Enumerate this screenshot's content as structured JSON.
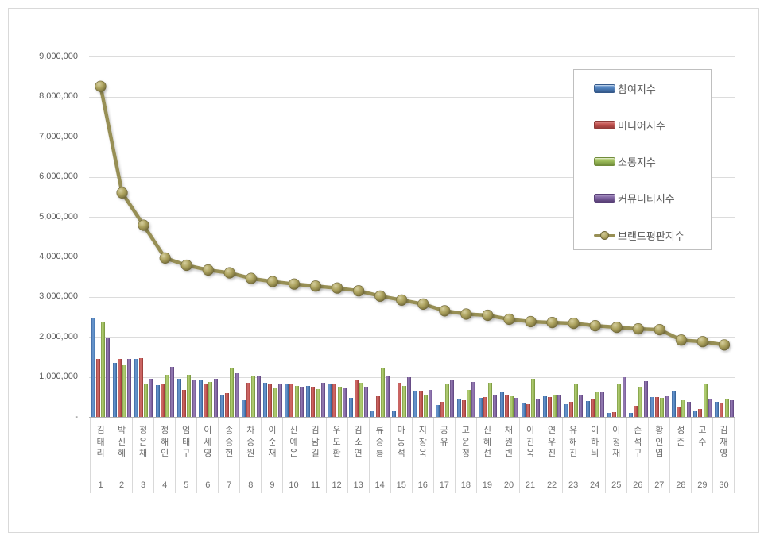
{
  "page": {
    "background": "#ffffff",
    "frame_border_color": "#d9d9d9"
  },
  "legend": {
    "position": "top-right",
    "items": [
      {
        "label": "참여지수",
        "type": "bar",
        "color": "#4F81BD"
      },
      {
        "label": "미디어지수",
        "type": "bar",
        "color": "#C0504D"
      },
      {
        "label": "소통지수",
        "type": "bar",
        "color": "#9BBB59"
      },
      {
        "label": "커뮤니티지수",
        "type": "bar",
        "color": "#8064A2"
      },
      {
        "label": "브랜드평판지수",
        "type": "line",
        "color": "#978F54"
      }
    ]
  },
  "y_axis": {
    "ticks": [
      "-",
      "1,000,000",
      "2,000,000",
      "3,000,000",
      "4,000,000",
      "5,000,000",
      "6,000,000",
      "7,000,000",
      "8,000,000",
      "9,000,000"
    ],
    "min": 0,
    "max": 9000000
  },
  "chart_data": {
    "type": "bar",
    "subtype": "clustered-bars-with-line-overlay",
    "grid": true,
    "legend_position": "top-right",
    "ylim": [
      0,
      9000000
    ],
    "xlabel": "",
    "ylabel": "",
    "title": "",
    "categories": [
      "김태리",
      "박신혜",
      "정은채",
      "정해인",
      "엄태구",
      "이세영",
      "송승헌",
      "차승원",
      "이순재",
      "신예은",
      "김남길",
      "우도환",
      "김소연",
      "류승룡",
      "마동석",
      "지창욱",
      "공유",
      "고윤정",
      "신혜선",
      "채원빈",
      "이진욱",
      "연우진",
      "유해진",
      "이하늬",
      "이정재",
      "손석구",
      "황인엽",
      "성준",
      "고수",
      "김재영"
    ],
    "ranks": [
      "1",
      "2",
      "3",
      "4",
      "5",
      "6",
      "7",
      "8",
      "9",
      "10",
      "11",
      "12",
      "13",
      "14",
      "15",
      "16",
      "17",
      "18",
      "19",
      "20",
      "21",
      "22",
      "23",
      "24",
      "25",
      "26",
      "27",
      "28",
      "29",
      "30"
    ],
    "series": [
      {
        "name": "참여지수",
        "type": "bar",
        "color": "#4F81BD",
        "values": [
          2480000,
          1350000,
          1450000,
          790000,
          950000,
          910000,
          550000,
          410000,
          860000,
          830000,
          780000,
          820000,
          480000,
          130000,
          150000,
          660000,
          290000,
          430000,
          480000,
          610000,
          360000,
          510000,
          320000,
          390000,
          90000,
          100000,
          490000,
          650000,
          140000,
          380000
        ]
      },
      {
        "name": "미디어지수",
        "type": "bar",
        "color": "#C0504D",
        "values": [
          1450000,
          1440000,
          1470000,
          820000,
          670000,
          840000,
          590000,
          860000,
          840000,
          830000,
          750000,
          820000,
          920000,
          510000,
          850000,
          660000,
          380000,
          410000,
          490000,
          560000,
          320000,
          490000,
          370000,
          440000,
          120000,
          280000,
          490000,
          260000,
          200000,
          340000
        ]
      },
      {
        "name": "소통지수",
        "type": "bar",
        "color": "#9BBB59",
        "values": [
          2380000,
          1290000,
          830000,
          1050000,
          1050000,
          880000,
          1230000,
          1030000,
          710000,
          780000,
          700000,
          750000,
          850000,
          1220000,
          780000,
          560000,
          820000,
          680000,
          850000,
          510000,
          950000,
          530000,
          840000,
          610000,
          830000,
          750000,
          480000,
          410000,
          830000,
          430000
        ]
      },
      {
        "name": "커뮤니티지수",
        "type": "bar",
        "color": "#8064A2",
        "values": [
          1980000,
          1450000,
          960000,
          1260000,
          930000,
          960000,
          1090000,
          1010000,
          830000,
          750000,
          860000,
          730000,
          750000,
          1020000,
          1000000,
          680000,
          930000,
          870000,
          530000,
          480000,
          460000,
          560000,
          550000,
          640000,
          1000000,
          890000,
          510000,
          380000,
          440000,
          410000
        ]
      },
      {
        "name": "브랜드평판지수",
        "type": "line",
        "color": "#978F54",
        "values": [
          8260000,
          5600000,
          4790000,
          3970000,
          3790000,
          3670000,
          3600000,
          3460000,
          3380000,
          3320000,
          3270000,
          3220000,
          3150000,
          3020000,
          2920000,
          2820000,
          2650000,
          2570000,
          2540000,
          2440000,
          2380000,
          2360000,
          2340000,
          2280000,
          2240000,
          2200000,
          2180000,
          1920000,
          1880000,
          1800000
        ]
      }
    ]
  }
}
